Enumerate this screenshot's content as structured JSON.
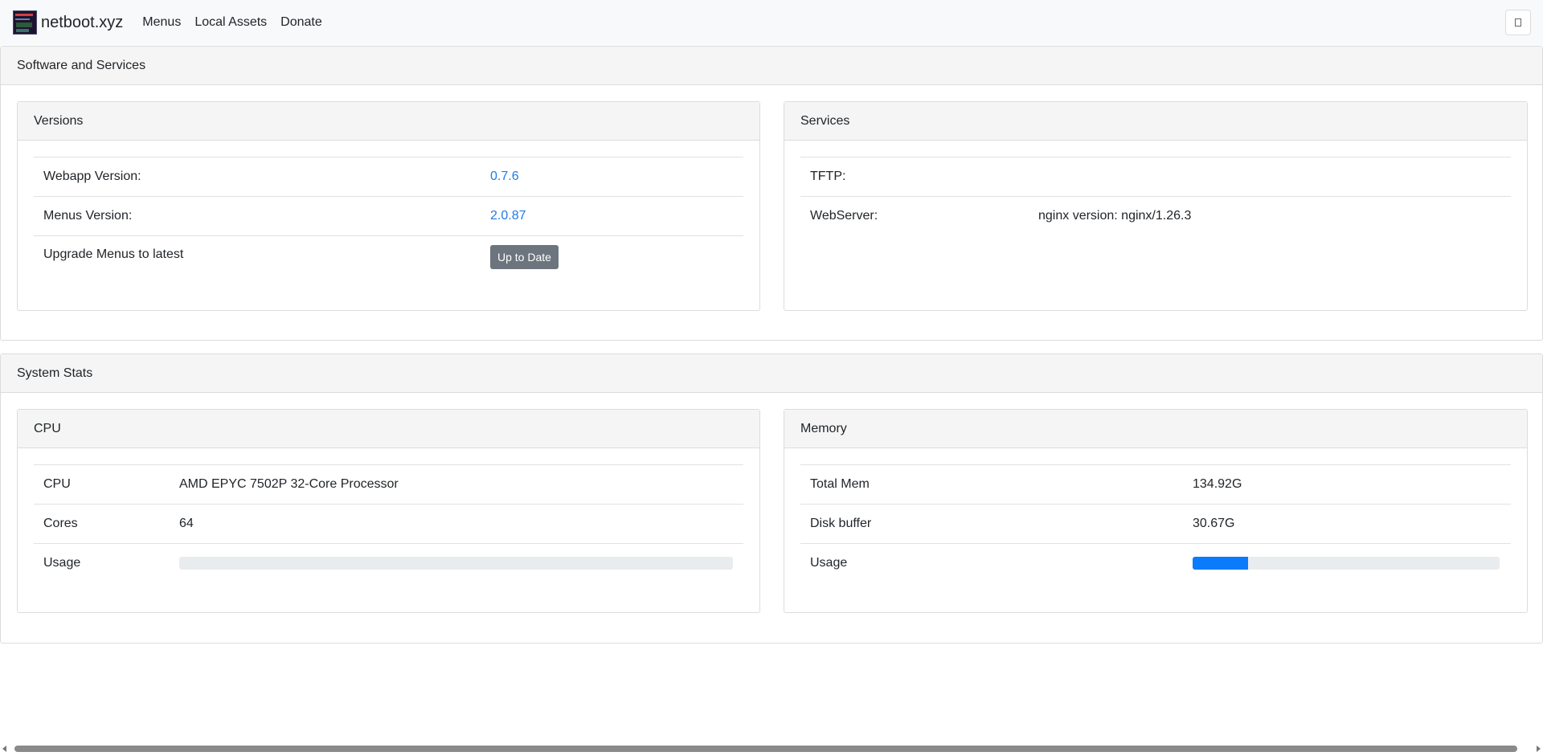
{
  "navbar": {
    "brand": "netboot.xyz",
    "links": [
      "Menus",
      "Local Assets",
      "Donate"
    ]
  },
  "software": {
    "title": "Software and Services",
    "versions": {
      "title": "Versions",
      "rows": [
        {
          "label": "Webapp Version:",
          "value": "0.7.6"
        },
        {
          "label": "Menus Version:",
          "value": "2.0.87"
        },
        {
          "label": "Upgrade Menus to latest",
          "button": "Up to Date"
        }
      ]
    },
    "services": {
      "title": "Services",
      "rows": [
        {
          "label": "TFTP:",
          "value": ""
        },
        {
          "label": "WebServer:",
          "value": "nginx version: nginx/1.26.3"
        }
      ]
    }
  },
  "system": {
    "title": "System Stats",
    "cpu": {
      "title": "CPU",
      "rows": [
        {
          "label": "CPU",
          "value": "AMD EPYC 7502P 32-Core Processor"
        },
        {
          "label": "Cores",
          "value": "64"
        },
        {
          "label": "Usage",
          "progress_percent": 0
        }
      ]
    },
    "memory": {
      "title": "Memory",
      "rows": [
        {
          "label": "Total Mem",
          "value": "134.92G"
        },
        {
          "label": "Disk buffer",
          "value": "30.67G"
        },
        {
          "label": "Usage",
          "progress_percent": 18
        }
      ]
    }
  },
  "colors": {
    "link": "#1e7be6",
    "progress": "#0a7bfa",
    "button": "#6c757d"
  }
}
